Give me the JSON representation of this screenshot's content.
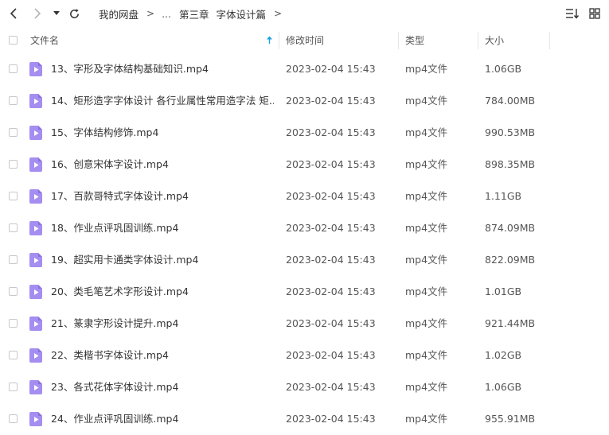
{
  "breadcrumb": {
    "root": "我的网盘",
    "ellipsis": "...",
    "chapter": "第三章",
    "folder": "字体设计篇"
  },
  "columns": {
    "name": "文件名",
    "modified": "修改时间",
    "type": "类型",
    "size": "大小"
  },
  "colors": {
    "accent": "#1aa2e8",
    "file_icon": "#a58ef0"
  },
  "files": [
    {
      "name": "13、字形及字体结构基础知识.mp4",
      "modified": "2023-02-04 15:43",
      "type": "mp4文件",
      "size": "1.06GB"
    },
    {
      "name": "14、矩形造字字体设计 各行业属性常用造字法 矩...",
      "modified": "2023-02-04 15:43",
      "type": "mp4文件",
      "size": "784.00MB"
    },
    {
      "name": "15、字体结构修饰.mp4",
      "modified": "2023-02-04 15:43",
      "type": "mp4文件",
      "size": "990.53MB"
    },
    {
      "name": "16、创意宋体字设计.mp4",
      "modified": "2023-02-04 15:43",
      "type": "mp4文件",
      "size": "898.35MB"
    },
    {
      "name": "17、百款哥特式字体设计.mp4",
      "modified": "2023-02-04 15:43",
      "type": "mp4文件",
      "size": "1.11GB"
    },
    {
      "name": "18、作业点评巩固训练.mp4",
      "modified": "2023-02-04 15:43",
      "type": "mp4文件",
      "size": "874.09MB"
    },
    {
      "name": "19、超实用卡通类字体设计.mp4",
      "modified": "2023-02-04 15:43",
      "type": "mp4文件",
      "size": "822.09MB"
    },
    {
      "name": "20、类毛笔艺术字形设计.mp4",
      "modified": "2023-02-04 15:43",
      "type": "mp4文件",
      "size": "1.01GB"
    },
    {
      "name": "21、篆隶字形设计提升.mp4",
      "modified": "2023-02-04 15:43",
      "type": "mp4文件",
      "size": "921.44MB"
    },
    {
      "name": "22、类楷书字体设计.mp4",
      "modified": "2023-02-04 15:43",
      "type": "mp4文件",
      "size": "1.02GB"
    },
    {
      "name": "23、各式花体字体设计.mp4",
      "modified": "2023-02-04 15:43",
      "type": "mp4文件",
      "size": "1.06GB"
    },
    {
      "name": "24、作业点评巩固训练.mp4",
      "modified": "2023-02-04 15:43",
      "type": "mp4文件",
      "size": "955.91MB"
    }
  ]
}
